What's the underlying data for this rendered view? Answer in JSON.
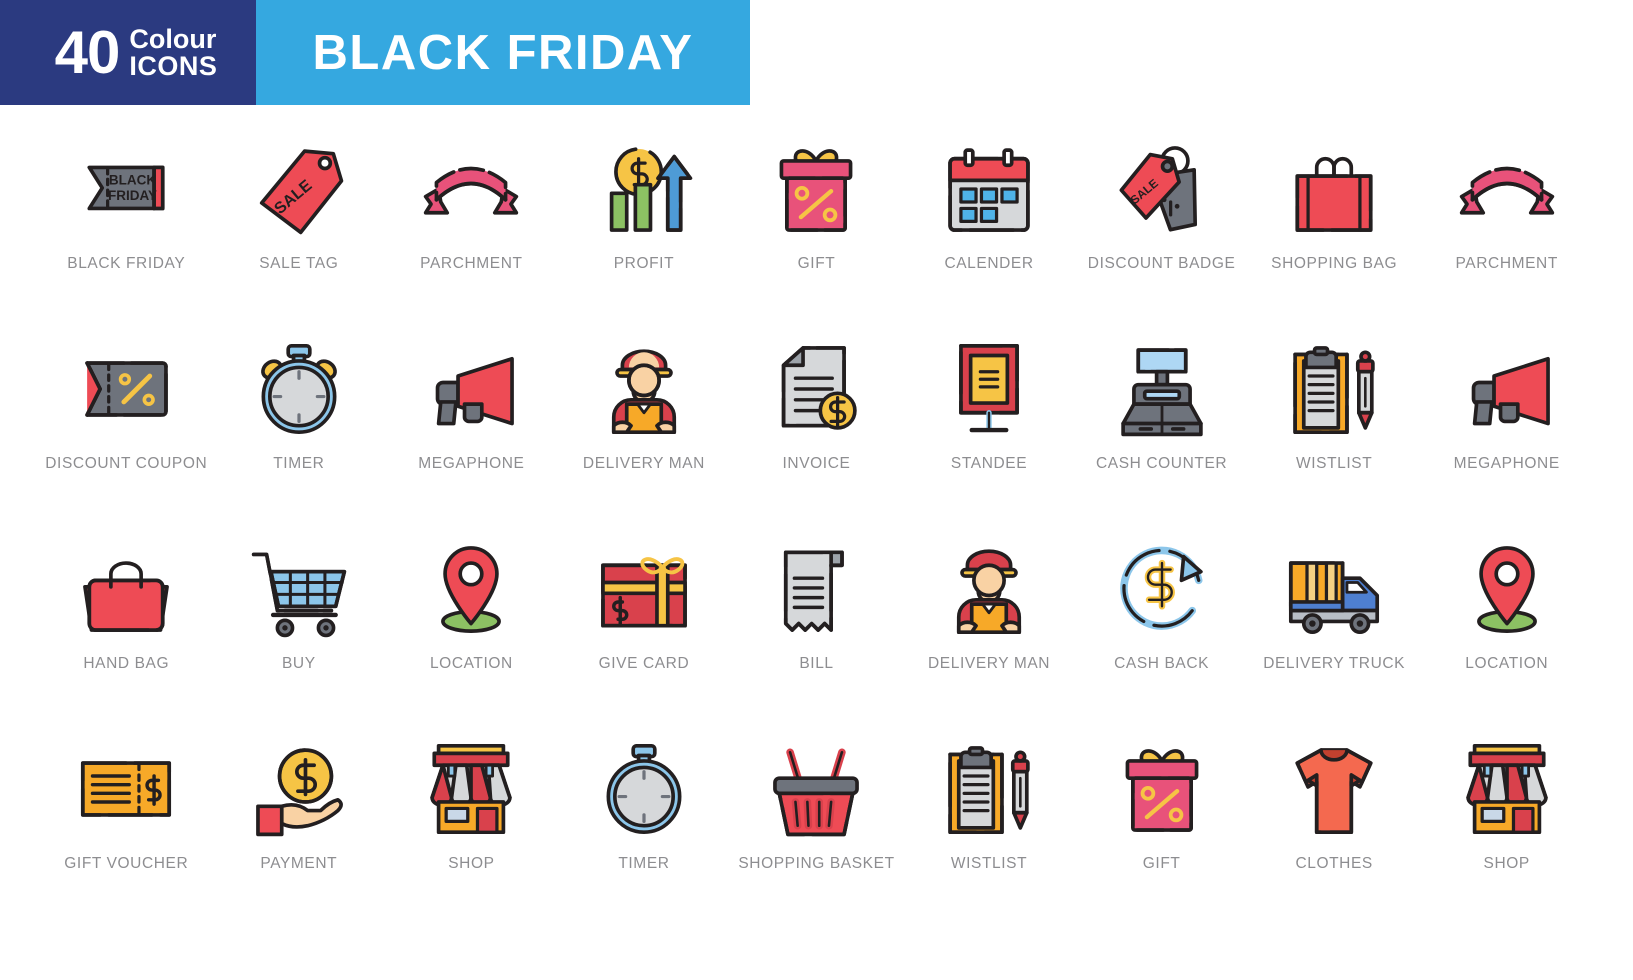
{
  "header": {
    "count": "40",
    "colour_word": "Colour",
    "icons_word": "ICONS",
    "title": "BLACK FRIDAY",
    "navy_hex": "#2B3A80",
    "blue_hex": "#35A8E0",
    "text_hex": "#FFFFFF"
  },
  "palette": {
    "outline": "#231F20",
    "red": "#EE4B55",
    "pink": "#E8527A",
    "deep_red": "#D9414C",
    "grey": "#6E737C",
    "light_grey": "#D6D8DA",
    "yellow": "#F6C445",
    "orange": "#F7A928",
    "light_blue": "#8CC6EA",
    "sky_blue": "#4E9BD6",
    "green": "#8CC163",
    "skin": "#F9D2A4",
    "coral": "#F4694F",
    "label_grey": "#8D8D90",
    "page_bg": "#FFFFFF"
  },
  "grid": {
    "columns": 9,
    "rows": 4,
    "total_icons": 40
  },
  "icons": [
    {
      "id": "black-friday",
      "label": "BLACK FRIDAY",
      "badge_line1": "BLACK",
      "badge_line2": "FRIDAY"
    },
    {
      "id": "sale-tag",
      "label": "SALE TAG",
      "badge_line1": "SALE"
    },
    {
      "id": "parchment",
      "label": "PARCHMENT"
    },
    {
      "id": "profit",
      "label": "PROFIT"
    },
    {
      "id": "gift",
      "label": "GIFT"
    },
    {
      "id": "calender",
      "label": "CALENDER"
    },
    {
      "id": "discount-badge",
      "label": "DISCOUNT BADGE",
      "badge_line1": "SALE"
    },
    {
      "id": "shopping-bag",
      "label": "SHOPPING BAG"
    },
    {
      "id": "parchment-2",
      "label": "PARCHMENT"
    },
    {
      "id": "discount-coupon",
      "label": "DISCOUNT COUPON"
    },
    {
      "id": "timer",
      "label": "TIMER"
    },
    {
      "id": "megaphone",
      "label": "MEGAPHONE"
    },
    {
      "id": "delivery-man",
      "label": "DELIVERY MAN"
    },
    {
      "id": "invoice",
      "label": "INVOICE"
    },
    {
      "id": "standee",
      "label": "STANDEE"
    },
    {
      "id": "cash-counter",
      "label": "CASH COUNTER"
    },
    {
      "id": "wistlist",
      "label": "WISTLIST"
    },
    {
      "id": "megaphone-2",
      "label": "MEGAPHONE"
    },
    {
      "id": "hand-bag",
      "label": "HAND BAG"
    },
    {
      "id": "buy",
      "label": "BUY"
    },
    {
      "id": "location",
      "label": "LOCATION"
    },
    {
      "id": "give-card",
      "label": "GIVE CARD"
    },
    {
      "id": "bill",
      "label": "BILL"
    },
    {
      "id": "delivery-man-2",
      "label": "DELIVERY MAN"
    },
    {
      "id": "cash-back",
      "label": "CASH BACK"
    },
    {
      "id": "delivery-truck",
      "label": "DELIVERY TRUCK"
    },
    {
      "id": "location-2",
      "label": "LOCATION"
    },
    {
      "id": "gift-voucher",
      "label": "GIFT VOUCHER"
    },
    {
      "id": "payment",
      "label": "PAYMENT"
    },
    {
      "id": "shop",
      "label": "SHOP"
    },
    {
      "id": "timer-2",
      "label": "TIMER"
    },
    {
      "id": "shopping-basket",
      "label": "SHOPPING BASKET"
    },
    {
      "id": "wistlist-2",
      "label": "WISTLIST"
    },
    {
      "id": "gift-2",
      "label": "GIFT"
    },
    {
      "id": "clothes",
      "label": "CLOTHES"
    },
    {
      "id": "shop-2",
      "label": "SHOP"
    }
  ]
}
